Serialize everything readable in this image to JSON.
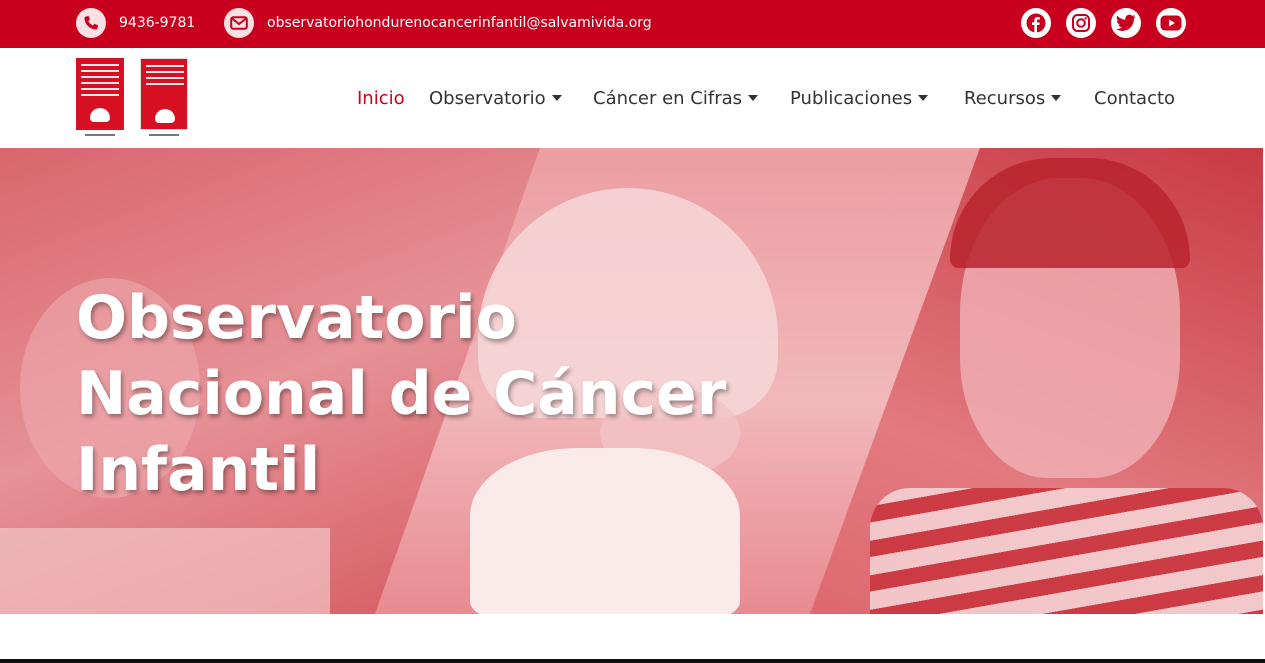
{
  "topbar": {
    "phone": {
      "icon": "phone-icon",
      "text": "9436-9781"
    },
    "email": {
      "icon": "envelope-icon",
      "text": "observatoriohondurenocancerinfantil@salvamivida.org"
    },
    "social": [
      "facebook-icon",
      "instagram-icon",
      "twitter-icon",
      "youtube-icon"
    ],
    "color": "#c8001e"
  },
  "navbar": {
    "items": [
      {
        "label": "Inicio",
        "active": true,
        "dropdown": false
      },
      {
        "label": "Observatorio",
        "active": false,
        "dropdown": true
      },
      {
        "label": "Cáncer en Cifras",
        "active": false,
        "dropdown": true
      },
      {
        "label": "Publicaciones",
        "active": false,
        "dropdown": true
      },
      {
        "label": "Recursos",
        "active": false,
        "dropdown": true
      },
      {
        "label": "Contacto",
        "active": false,
        "dropdown": false
      }
    ],
    "active_color": "#c8001e"
  },
  "hero": {
    "title_lines": [
      "Observatorio",
      "Nacional de Cáncer",
      "Infantil"
    ],
    "tint": "#e8878c"
  }
}
